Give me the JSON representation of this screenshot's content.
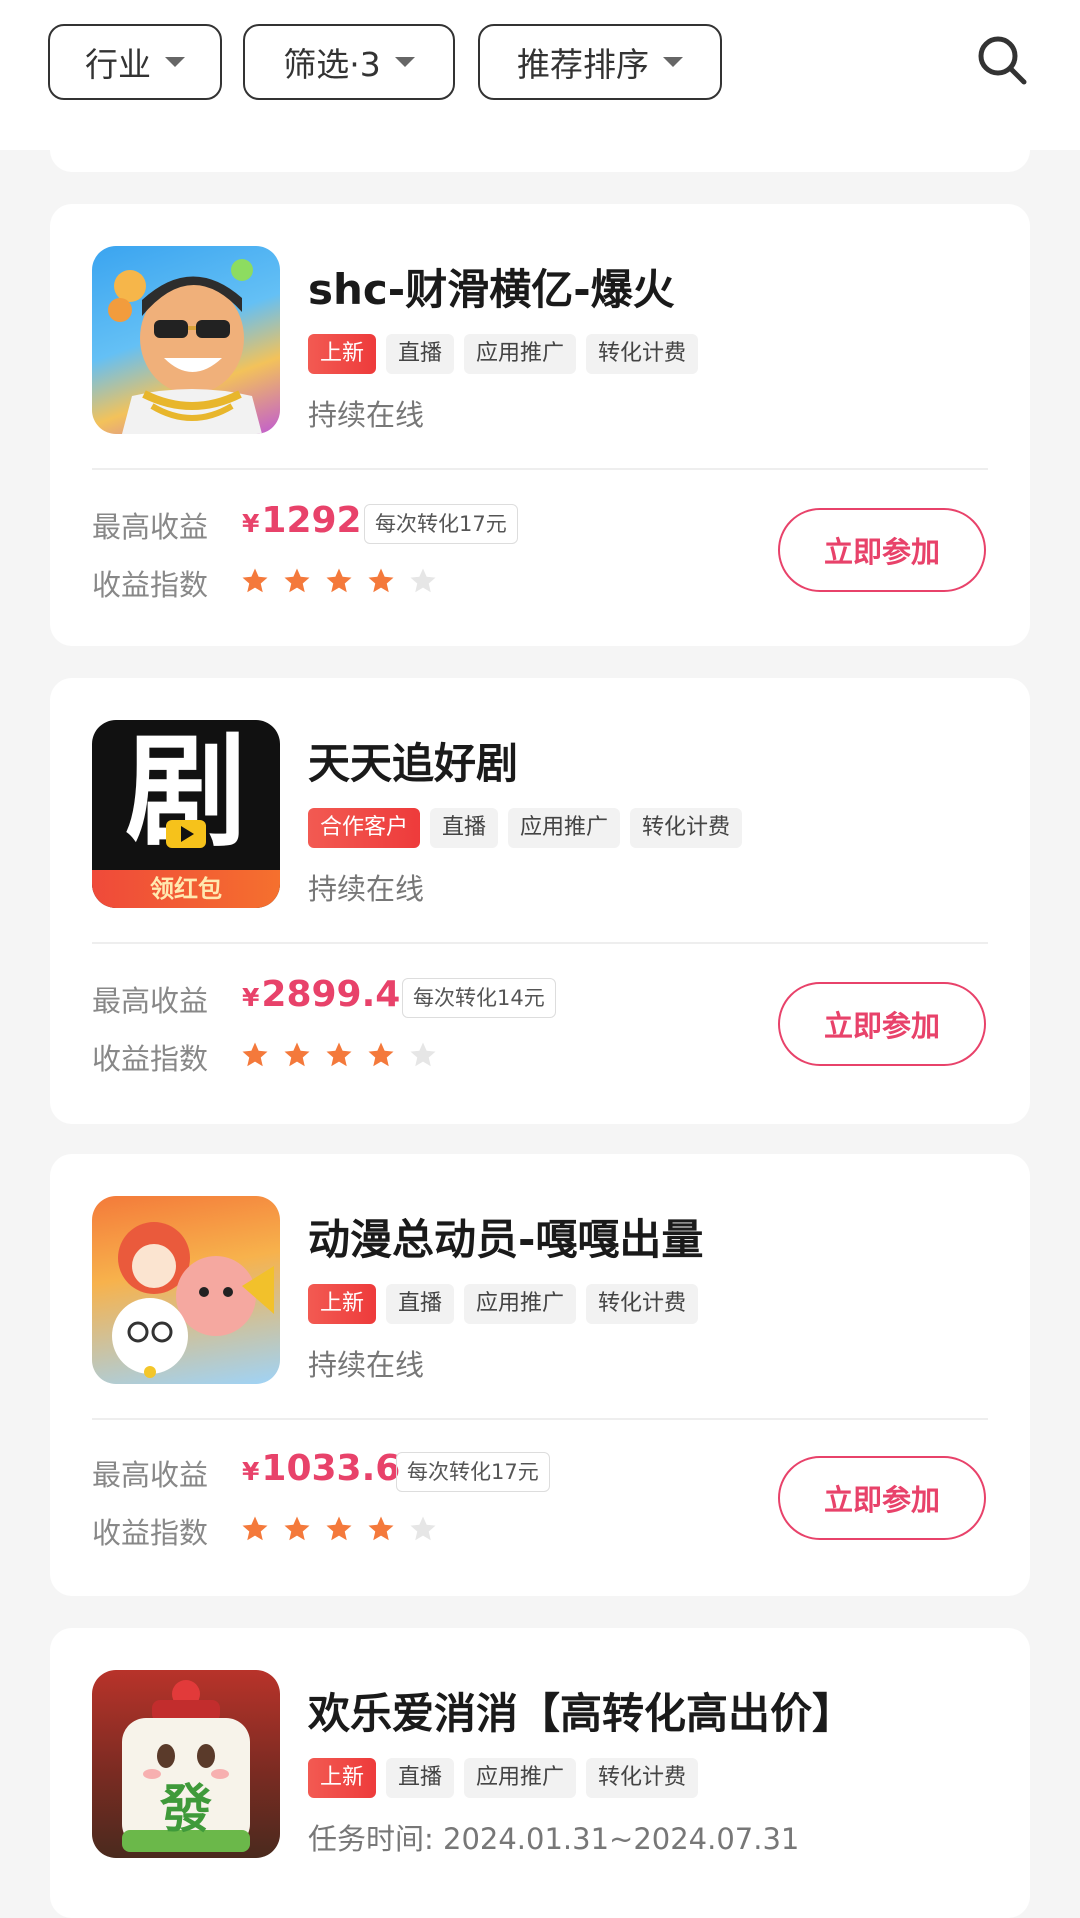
{
  "filters": {
    "industry": "行业",
    "filter": "筛选·3",
    "sort": "推荐排序"
  },
  "colors": {
    "accent": "#e8426a",
    "tag_hot": "#ee3b3b",
    "star_on": "#f4793b",
    "star_off": "#e6e6e6"
  },
  "labels": {
    "max_income": "最高收益",
    "income_index": "收益指数",
    "join": "立即参加"
  },
  "cards": [
    {
      "title": "shc-财滑横亿-爆火",
      "icon": "game-character-icon",
      "tags": [
        "上新",
        "直播",
        "应用推广",
        "转化计费"
      ],
      "status": "持续在线",
      "currency": "¥",
      "max_income": "1292",
      "per_conversion": "每次转化17元",
      "rating": 4,
      "rating_max": 5
    },
    {
      "title": "天天追好剧",
      "icon": "drama-app-icon",
      "icon_text": "剧",
      "icon_badge": "领红包",
      "tags": [
        "合作客户",
        "直播",
        "应用推广",
        "转化计费"
      ],
      "status": "持续在线",
      "currency": "¥",
      "max_income": "2899.4",
      "per_conversion": "每次转化14元",
      "rating": 4,
      "rating_max": 5
    },
    {
      "title": "动漫总动员-嘎嘎出量",
      "icon": "cartoon-characters-icon",
      "tags": [
        "上新",
        "直播",
        "应用推广",
        "转化计费"
      ],
      "status": "持续在线",
      "currency": "¥",
      "max_income": "1033.6",
      "per_conversion": "每次转化17元",
      "rating": 4,
      "rating_max": 5
    },
    {
      "title": "欢乐爱消消【高转化高出价】",
      "icon": "mahjong-tile-icon",
      "icon_text": "發",
      "tags": [
        "上新",
        "直播",
        "应用推广",
        "转化计费"
      ],
      "status": "任务时间: 2024.01.31~2024.07.31"
    }
  ]
}
